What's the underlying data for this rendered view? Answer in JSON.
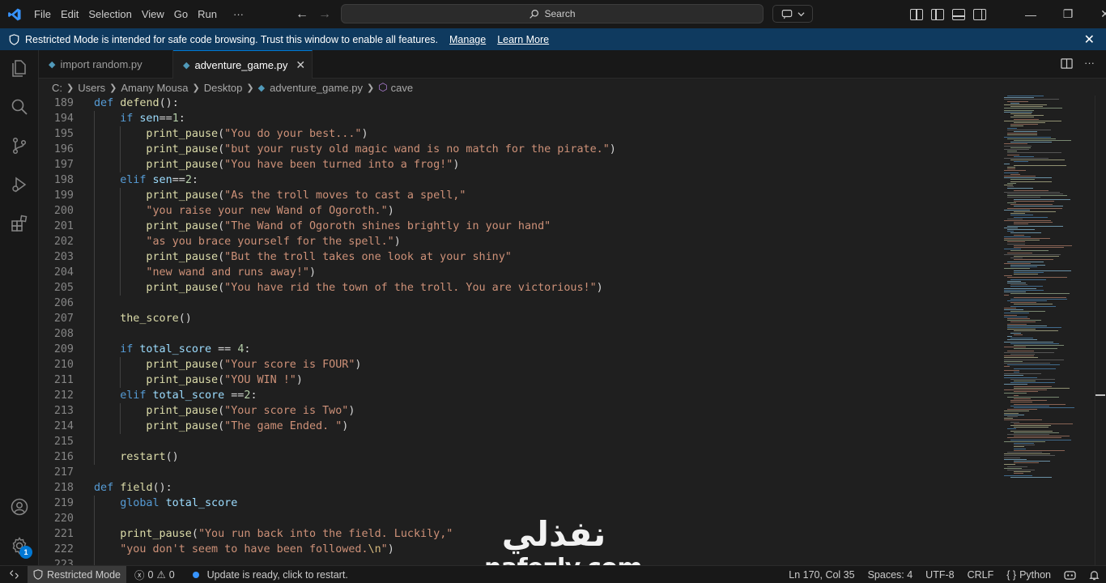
{
  "menu": [
    "File",
    "Edit",
    "Selection",
    "View",
    "Go",
    "Run",
    "···"
  ],
  "search": {
    "label": "Search"
  },
  "banner": {
    "message": "Restricted Mode is intended for safe code browsing. Trust this window to enable all features.",
    "manage": "Manage",
    "learn_more": "Learn More"
  },
  "tabs": [
    {
      "label": "import random.py",
      "active": false
    },
    {
      "label": "adventure_game.py",
      "active": true
    }
  ],
  "breadcrumbs": [
    "C:",
    "Users",
    "Amany Mousa",
    "Desktop",
    "adventure_game.py",
    "cave"
  ],
  "editor": {
    "lines": [
      {
        "n": "189",
        "indent": 0,
        "tokens": [
          [
            "kw",
            "def "
          ],
          [
            "fn",
            "defend"
          ],
          [
            "op",
            "():"
          ]
        ]
      },
      {
        "n": "194",
        "indent": 1,
        "tokens": [
          [
            "kw",
            "if "
          ],
          [
            "var",
            "sen"
          ],
          [
            "op",
            "=="
          ],
          [
            "num",
            "1"
          ],
          [
            "op",
            ":"
          ]
        ]
      },
      {
        "n": "195",
        "indent": 2,
        "tokens": [
          [
            "fn",
            "print_pause"
          ],
          [
            "op",
            "("
          ],
          [
            "str",
            "\"You do your best...\""
          ],
          [
            "op",
            ")"
          ]
        ]
      },
      {
        "n": "196",
        "indent": 2,
        "tokens": [
          [
            "fn",
            "print_pause"
          ],
          [
            "op",
            "("
          ],
          [
            "str",
            "\"but your rusty old magic wand is no match for the pirate.\""
          ],
          [
            "op",
            ")"
          ]
        ]
      },
      {
        "n": "197",
        "indent": 2,
        "tokens": [
          [
            "fn",
            "print_pause"
          ],
          [
            "op",
            "("
          ],
          [
            "str",
            "\"You have been turned into a frog!\""
          ],
          [
            "op",
            ")"
          ]
        ]
      },
      {
        "n": "198",
        "indent": 1,
        "tokens": [
          [
            "kw",
            "elif "
          ],
          [
            "var",
            "sen"
          ],
          [
            "op",
            "=="
          ],
          [
            "num",
            "2"
          ],
          [
            "op",
            ":"
          ]
        ]
      },
      {
        "n": "199",
        "indent": 2,
        "tokens": [
          [
            "fn",
            "print_pause"
          ],
          [
            "op",
            "("
          ],
          [
            "str",
            "\"As the troll moves to cast a spell,\""
          ]
        ]
      },
      {
        "n": "200",
        "indent": 2,
        "tokens": [
          [
            "str",
            "\"you raise your new Wand of Ogoroth.\""
          ],
          [
            "op",
            ")"
          ]
        ]
      },
      {
        "n": "201",
        "indent": 2,
        "tokens": [
          [
            "fn",
            "print_pause"
          ],
          [
            "op",
            "("
          ],
          [
            "str",
            "\"The Wand of Ogoroth shines brightly in your hand\""
          ]
        ]
      },
      {
        "n": "202",
        "indent": 2,
        "tokens": [
          [
            "str",
            "\"as you brace yourself for the spell.\""
          ],
          [
            "op",
            ")"
          ]
        ]
      },
      {
        "n": "203",
        "indent": 2,
        "tokens": [
          [
            "fn",
            "print_pause"
          ],
          [
            "op",
            "("
          ],
          [
            "str",
            "\"But the troll takes one look at your shiny\""
          ]
        ]
      },
      {
        "n": "204",
        "indent": 2,
        "tokens": [
          [
            "str",
            "\"new wand and runs away!\""
          ],
          [
            "op",
            ")"
          ]
        ]
      },
      {
        "n": "205",
        "indent": 2,
        "tokens": [
          [
            "fn",
            "print_pause"
          ],
          [
            "op",
            "("
          ],
          [
            "str",
            "\"You have rid the town of the troll. You are victorious!\""
          ],
          [
            "op",
            ")"
          ]
        ]
      },
      {
        "n": "206",
        "indent": 1,
        "tokens": []
      },
      {
        "n": "207",
        "indent": 1,
        "tokens": [
          [
            "fn",
            "the_score"
          ],
          [
            "op",
            "()"
          ]
        ]
      },
      {
        "n": "208",
        "indent": 1,
        "tokens": []
      },
      {
        "n": "209",
        "indent": 1,
        "tokens": [
          [
            "kw",
            "if "
          ],
          [
            "var",
            "total_score"
          ],
          [
            "op",
            " == "
          ],
          [
            "num",
            "4"
          ],
          [
            "op",
            ":"
          ]
        ]
      },
      {
        "n": "210",
        "indent": 2,
        "tokens": [
          [
            "fn",
            "print_pause"
          ],
          [
            "op",
            "("
          ],
          [
            "str",
            "\"Your score is FOUR\""
          ],
          [
            "op",
            ")"
          ]
        ]
      },
      {
        "n": "211",
        "indent": 2,
        "tokens": [
          [
            "fn",
            "print_pause"
          ],
          [
            "op",
            "("
          ],
          [
            "str",
            "\"YOU WIN !\""
          ],
          [
            "op",
            ")"
          ]
        ]
      },
      {
        "n": "212",
        "indent": 1,
        "tokens": [
          [
            "kw",
            "elif "
          ],
          [
            "var",
            "total_score"
          ],
          [
            "op",
            " =="
          ],
          [
            "num",
            "2"
          ],
          [
            "op",
            ":"
          ]
        ]
      },
      {
        "n": "213",
        "indent": 2,
        "tokens": [
          [
            "fn",
            "print_pause"
          ],
          [
            "op",
            "("
          ],
          [
            "str",
            "\"Your score is Two\""
          ],
          [
            "op",
            ")"
          ]
        ]
      },
      {
        "n": "214",
        "indent": 2,
        "tokens": [
          [
            "fn",
            "print_pause"
          ],
          [
            "op",
            "("
          ],
          [
            "str",
            "\"The game Ended. \""
          ],
          [
            "op",
            ")"
          ]
        ]
      },
      {
        "n": "215",
        "indent": 1,
        "tokens": []
      },
      {
        "n": "216",
        "indent": 1,
        "tokens": [
          [
            "fn",
            "restart"
          ],
          [
            "op",
            "()"
          ]
        ]
      },
      {
        "n": "217",
        "indent": 0,
        "tokens": []
      },
      {
        "n": "218",
        "indent": 0,
        "tokens": [
          [
            "kw",
            "def "
          ],
          [
            "fn",
            "field"
          ],
          [
            "op",
            "():"
          ]
        ]
      },
      {
        "n": "219",
        "indent": 1,
        "tokens": [
          [
            "kw",
            "global "
          ],
          [
            "var",
            "total_score"
          ]
        ]
      },
      {
        "n": "220",
        "indent": 1,
        "tokens": []
      },
      {
        "n": "221",
        "indent": 1,
        "tokens": [
          [
            "fn",
            "print_pause"
          ],
          [
            "op",
            "("
          ],
          [
            "str",
            "\"You run back into the field. Luckily,\""
          ]
        ]
      },
      {
        "n": "222",
        "indent": 1,
        "tokens": [
          [
            "str",
            "\"you don't seem to have been followed."
          ],
          [
            "esc",
            "\\n"
          ],
          [
            "str",
            "\""
          ],
          [
            "op",
            ")"
          ]
        ]
      },
      {
        "n": "223",
        "indent": 1,
        "tokens": []
      }
    ]
  },
  "watermark": {
    "arabic": "نفذلي",
    "latin": "nafezly.com"
  },
  "statusbar": {
    "restricted": "Restricted Mode",
    "errors": "0",
    "warnings": "0",
    "update": "Update is ready, click to restart.",
    "position": "Ln 170, Col 35",
    "spaces": "Spaces: 4",
    "encoding": "UTF-8",
    "eol": "CRLF",
    "language": "Python",
    "accounts_badge": "1"
  },
  "colors": {
    "accent": "#0078d4",
    "banner": "#0f3a5f",
    "keyword": "#569cd6",
    "function": "#dcdcaa",
    "string": "#ce9178",
    "variable": "#9cdcfe"
  }
}
